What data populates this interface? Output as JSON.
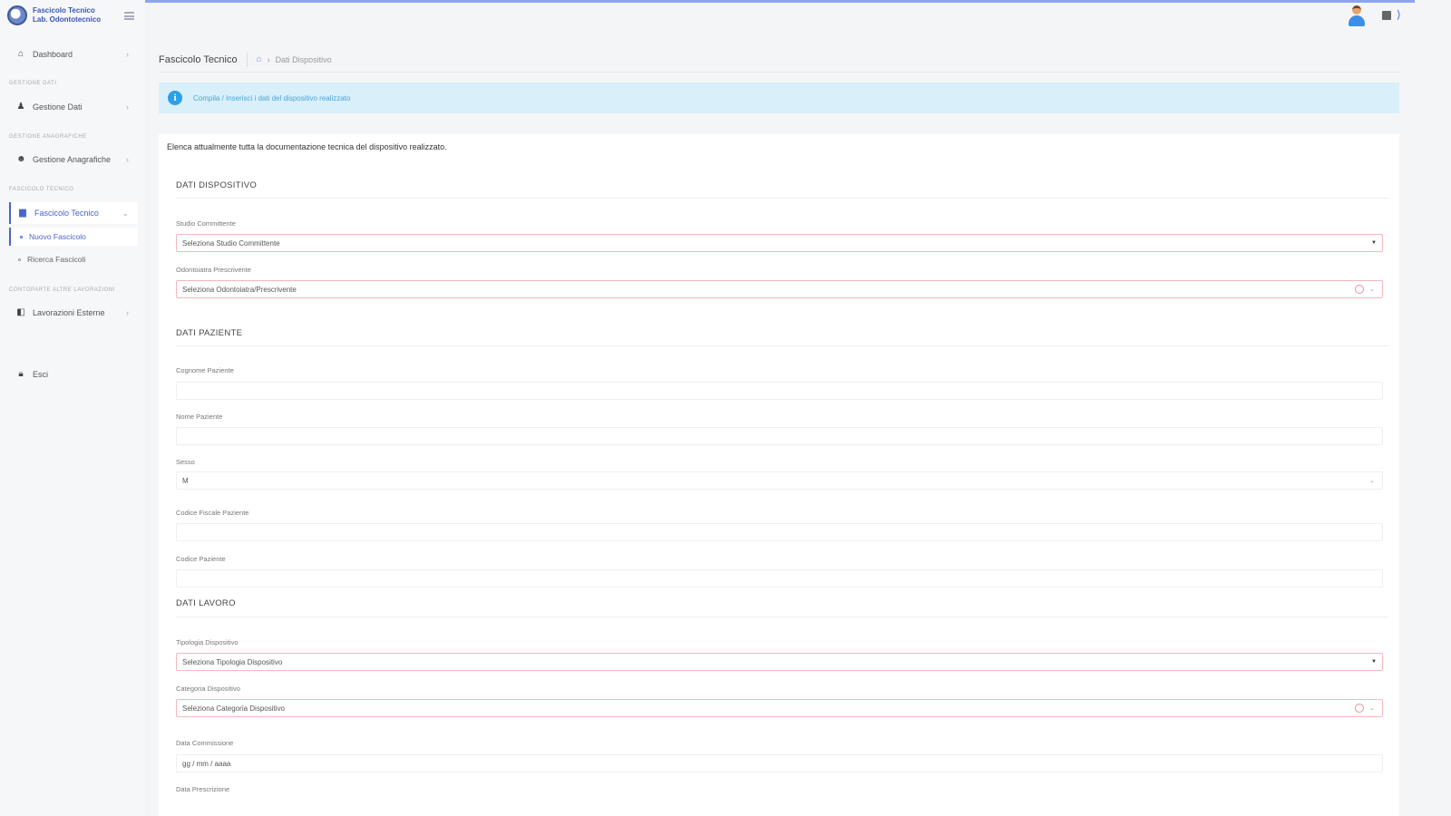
{
  "brand": {
    "line1": "Fascicolo Tecnico",
    "line2": "Lab. Odontotecnico"
  },
  "sidebar": {
    "dashboard": "Dashboard",
    "section_dati": "GESTIONE DATI",
    "gestione_dati": "Gestione Dati",
    "section_anagrafiche": "GESTIONE ANAGRAFICHE",
    "gestione_anagrafiche": "Gestione Anagrafiche",
    "section_fascicoli": "FASCICOLO TECNICO",
    "fascicolo_tecnico": "Fascicolo Tecnico",
    "nuovo_fascicolo": "Nuovo Fascicolo",
    "ricerca_fascicoli": "Ricerca Fascicoli",
    "section_lab": "CONTOPARTE ALTRE LAVORAZIONI",
    "lavorazioni_esterne": "Lavorazioni Esterne",
    "esci": "Esci"
  },
  "header": {
    "title": "Fascicolo Tecnico",
    "crumb": "Dati Dispositivo"
  },
  "alert": {
    "text": "Compila / Inserisci i dati del dispositivo realizzato"
  },
  "form": {
    "intro": "Elenca attualmente tutta la documentazione tecnica del dispositivo realizzato.",
    "section_dispositivo": "DATI DISPOSITIVO",
    "studio_label": "Studio Committente",
    "studio_value": "Seleziona Studio Committente",
    "odontoiatra_label": "Odontoiatra Prescrivente",
    "odontoiatra_value": "Seleziona Odontoiatra/Prescrivente",
    "section_paziente": "DATI PAZIENTE",
    "cognome_label": "Cognome Paziente",
    "nome_label": "Nome Paziente",
    "sesso_label": "Sesso",
    "sesso_value": "M",
    "cf_label": "Codice Fiscale Paziente",
    "codice_label": "Codice Paziente",
    "section_lavoro": "DATI LAVORO",
    "tipologia_label": "Tipologia Dispositivo",
    "tipologia_value": "Seleziona Tipologia Dispositivo",
    "categoria_label": "Categoria Dispositivo",
    "categoria_value": "Seleziona Categoria Dispositivo",
    "data_comm_label": "Data Commissione",
    "data_comm_value": "gg / mm / aaaa",
    "data_pres_label": "Data Prescrizione"
  }
}
